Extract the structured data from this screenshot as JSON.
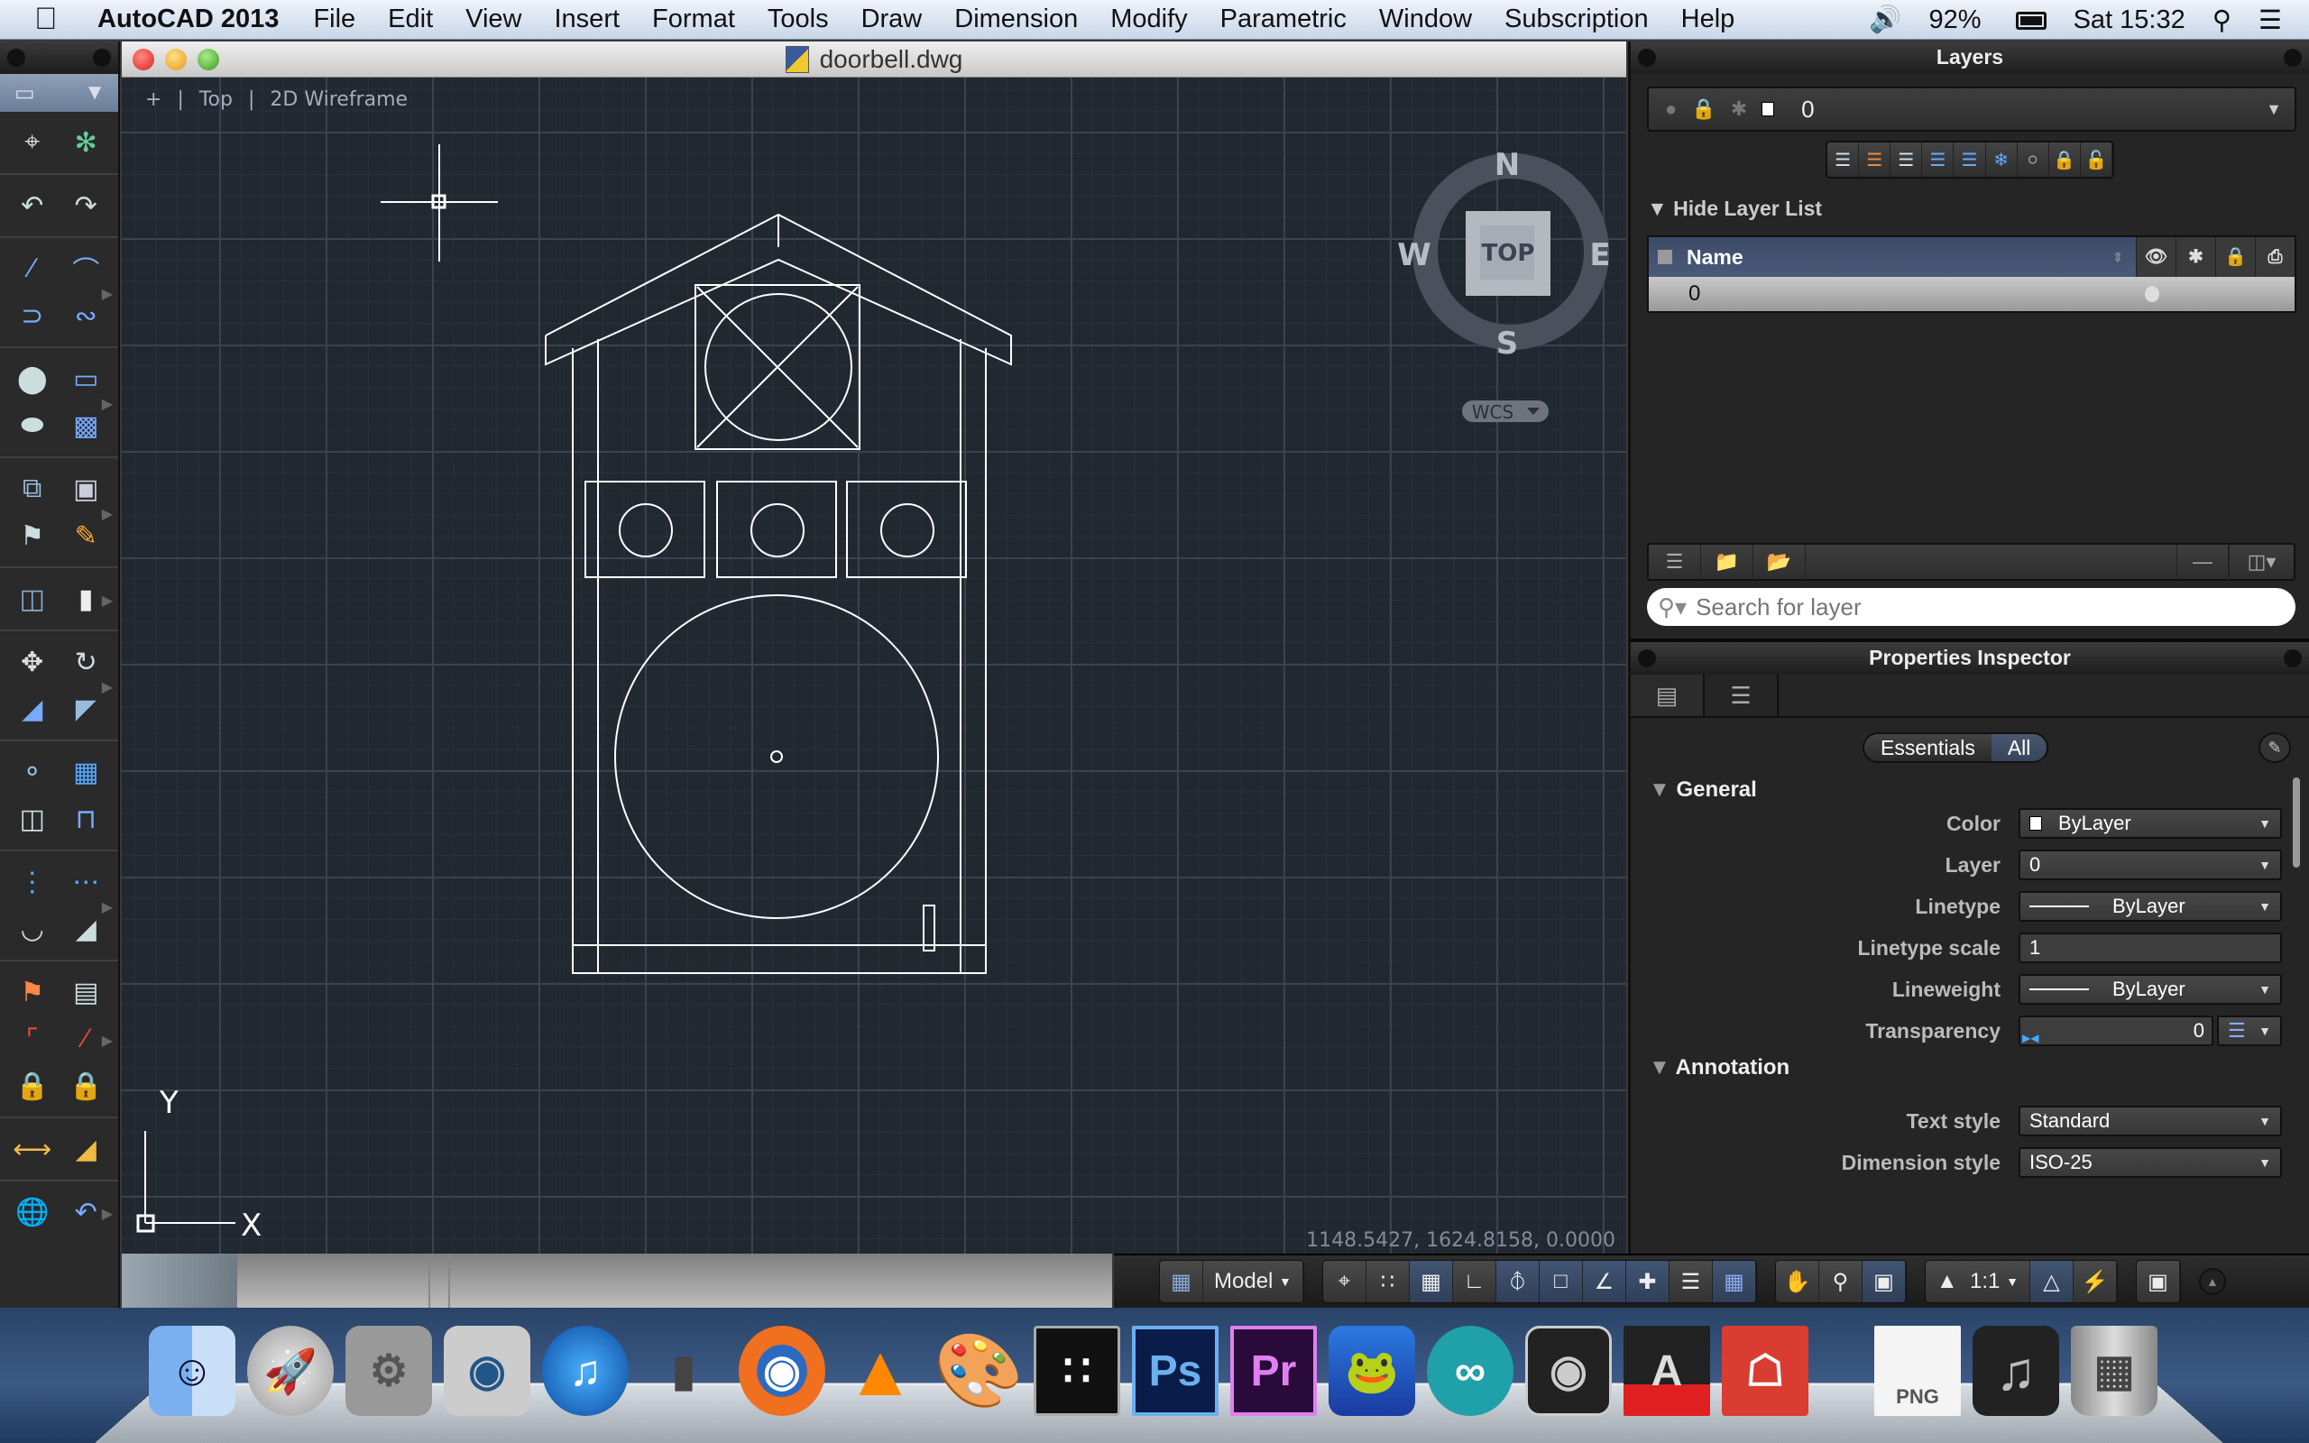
{
  "menubar": {
    "app_name": "AutoCAD 2013",
    "items": [
      "File",
      "Edit",
      "View",
      "Insert",
      "Format",
      "Tools",
      "Draw",
      "Dimension",
      "Modify",
      "Parametric",
      "Window",
      "Subscription",
      "Help"
    ],
    "battery": "92%",
    "clock": "Sat 15:32"
  },
  "left_toolbar": {
    "selection_mode_icon": "selection-rectangle-icon",
    "groups": [
      [
        "crosshair-select-icon",
        "quick-select-icon"
      ],
      [
        "undo-icon",
        "redo-icon"
      ],
      [
        "line-icon",
        "arc-icon",
        "polyline-icon",
        "spline-icon"
      ],
      [
        "circle-icon",
        "rectangle-icon",
        "ellipse-icon",
        "hatch-icon"
      ],
      [
        "insert-block-icon",
        "create-block-icon",
        "attribute-define-icon",
        "attribute-edit-icon"
      ],
      [
        "extrude-icon",
        "erase-icon"
      ],
      [
        "move-icon",
        "rotate-icon",
        "scale-icon",
        "stretch-icon"
      ],
      [
        "copy-icon",
        "array-icon",
        "mirror-icon",
        "offset-icon"
      ],
      [
        "trim-icon",
        "extend-icon",
        "fillet-icon",
        "chamfer-icon"
      ],
      [
        "auto-constrain-icon",
        "constraint-settings-icon",
        "coincident-icon",
        "parallel-icon",
        "dim-constraint-linear-icon",
        "dim-constraint-aligned-icon"
      ],
      [
        "linear-dimension-icon",
        "angular-dimension-icon"
      ],
      [
        "ucs-world-icon",
        "ucs-previous-icon"
      ]
    ]
  },
  "drawing_window": {
    "filename": "doorbell.dwg",
    "viewport_controls": [
      "+",
      "Top",
      "2D Wireframe"
    ],
    "coordinates": "1148.5427, 1624.8158, 0.0000",
    "viewcube": {
      "face": "TOP",
      "north": "N",
      "south": "S",
      "east": "E",
      "west": "W",
      "ucs": "WCS"
    },
    "ucs_icon": {
      "x": "X",
      "y": "Y"
    },
    "colors": {
      "background": "#212830",
      "grid_major": "#3b4250",
      "lines": "#ffffff"
    }
  },
  "status_bar": {
    "layout_select": "Model",
    "drafting_tools": [
      {
        "name": "snap-mode",
        "on": false
      },
      {
        "name": "grid-snap",
        "on": false
      },
      {
        "name": "grid-display",
        "on": true
      },
      {
        "name": "ortho-mode",
        "on": false
      },
      {
        "name": "polar-tracking",
        "on": true
      },
      {
        "name": "object-snap",
        "on": true
      },
      {
        "name": "object-snap-tracking",
        "on": true
      },
      {
        "name": "dynamic-ucs",
        "on": true
      },
      {
        "name": "lineweight",
        "on": false
      },
      {
        "name": "transparency",
        "on": true
      }
    ],
    "nav_tools": [
      "pan",
      "zoom",
      "orbit"
    ],
    "annotation_scale": "1:1"
  },
  "layers_panel": {
    "title": "Layers",
    "current_layer": "0",
    "toggle_label": "Hide Layer List",
    "table_header": {
      "name": "Name"
    },
    "rows": [
      {
        "name": "0",
        "visible": true
      }
    ],
    "search_placeholder": "Search for layer"
  },
  "properties_inspector": {
    "title": "Properties Inspector",
    "segments": [
      "Essentials",
      "All"
    ],
    "active_segment": "All",
    "sections": [
      {
        "title": "General",
        "rows": [
          {
            "label": "Color",
            "value": "ByLayer",
            "type": "select",
            "swatch": true
          },
          {
            "label": "Layer",
            "value": "0",
            "type": "select"
          },
          {
            "label": "Linetype",
            "value": "ByLayer",
            "type": "select",
            "line": true
          },
          {
            "label": "Linetype scale",
            "value": "1",
            "type": "text"
          },
          {
            "label": "Lineweight",
            "value": "ByLayer",
            "type": "select",
            "line": true
          },
          {
            "label": "Transparency",
            "value": "0",
            "type": "slider"
          }
        ]
      },
      {
        "title": "Annotation",
        "rows": [
          {
            "label": "Text style",
            "value": "Standard",
            "type": "select"
          },
          {
            "label": "Dimension style",
            "value": "ISO-25",
            "type": "select"
          }
        ]
      }
    ]
  },
  "dock": {
    "apps": [
      "Finder",
      "Launchpad",
      "System Preferences",
      "FaceTime",
      "iTunes",
      "PS3 Media Server",
      "Firefox",
      "VLC",
      "Paintbrush",
      "Cura",
      "Photoshop",
      "Premiere Pro",
      "Vuze",
      "Arduino",
      "Logic Pro",
      "AutoCAD",
      "SketchUp"
    ],
    "stacks": [
      "PNG",
      "Music",
      "Trash"
    ]
  }
}
